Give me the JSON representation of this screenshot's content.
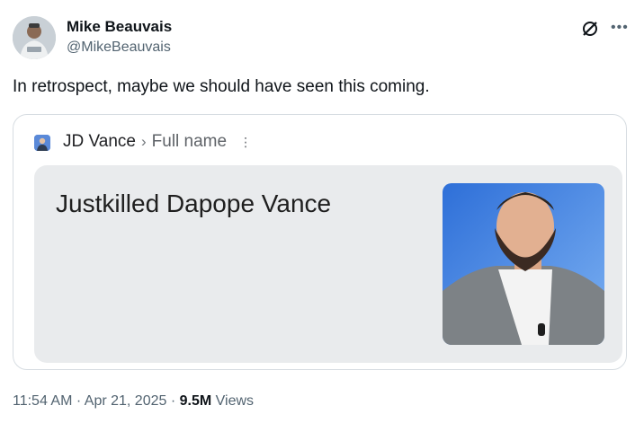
{
  "author": {
    "name": "Mike Beauvais",
    "handle": "@MikeBeauvais"
  },
  "tweet": {
    "text": "In retrospect, maybe we should have seen this coming."
  },
  "card": {
    "search_name": "JD Vance",
    "search_separator": "›",
    "search_label": "Full name",
    "result_title": "Justkilled Dapope Vance"
  },
  "meta": {
    "time": "11:54 AM",
    "date": "Apr 21, 2025",
    "views_count": "9.5M",
    "views_label": "Views"
  },
  "icons": {
    "grok": "grok-icon",
    "more": "more-icon",
    "kebab": "kebab-icon"
  },
  "colors": {
    "text_primary": "#0f1419",
    "text_secondary": "#536471",
    "panel_bg": "#e9ebed",
    "photo_bg": "#3f86e6"
  }
}
